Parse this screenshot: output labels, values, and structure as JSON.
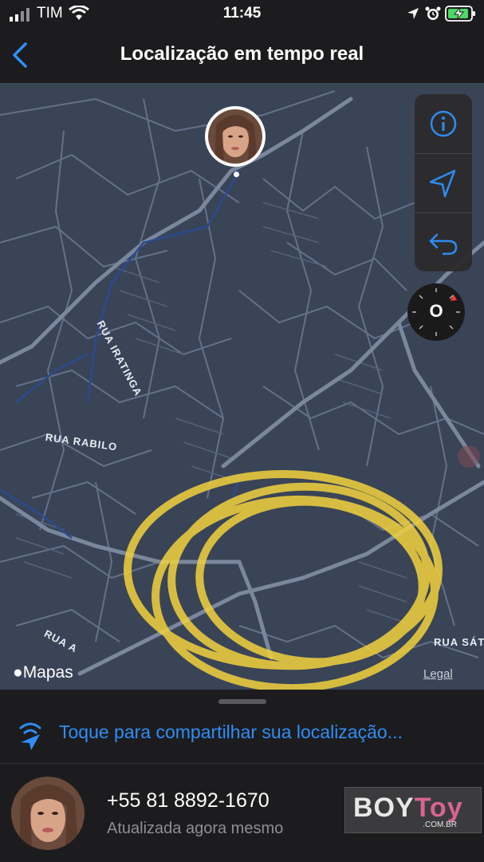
{
  "status_bar": {
    "carrier": "TIM",
    "time": "11:45",
    "icons": [
      "signal-icon",
      "wifi-icon",
      "location-arrow-icon",
      "alarm-icon",
      "battery-charging-icon"
    ]
  },
  "nav": {
    "title": "Localização em tempo real",
    "back_icon": "chevron-left-icon"
  },
  "map": {
    "street_labels": [
      "RUA IRATINGA",
      "RUA RABILO",
      "RUA A",
      "RUA SÁTIR"
    ],
    "controls": [
      "info-icon",
      "location-arrow-icon",
      "undo-arrow-icon"
    ],
    "compass_letter": "O",
    "attribution": "Mapas",
    "legal_label": "Legal",
    "highlight_color": "#f2d23c"
  },
  "sheet": {
    "share_label": "Toque para compartilhar sua localização...",
    "share_icon": "share-location-icon",
    "contact": {
      "name": "+55 81 8892-1670",
      "status": "Atualizada agora mesmo"
    }
  },
  "watermark": {
    "boy": "BOY",
    "toy": "Toy",
    "domain": ".COM.BR"
  },
  "colors": {
    "accent": "#2f8ef5",
    "map_background": "#394457",
    "street": "#6f7c92"
  }
}
